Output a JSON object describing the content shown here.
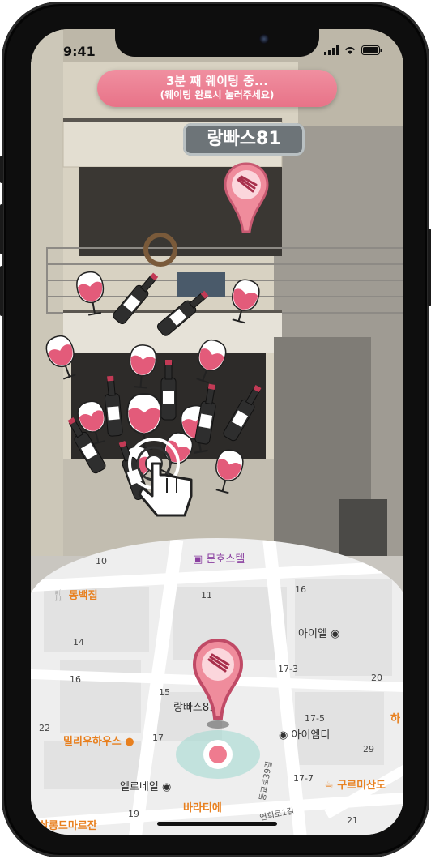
{
  "status_bar": {
    "time": "9:41"
  },
  "banner": {
    "line1": "3분 째 웨이팅 중...",
    "line2": "(웨이팅 완료시 눌러주세요)"
  },
  "place_name": "랑빠스81",
  "colors": {
    "accent": "#e87388",
    "banner_text": "#ffffff",
    "map_orange": "#e8801f"
  },
  "map": {
    "labels": {
      "munhostel": "문호스텔",
      "dongbaek": "동백집",
      "aiel": "아이엘",
      "langpas": "랑빠스81",
      "aiemdi": "아이엠디",
      "milliu": "밀리우하우스",
      "elnail": "엘르네일",
      "barati": "바라티에",
      "gurumi": "구르미산도",
      "salong": "살롱드마르잔",
      "ha": "하",
      "road1": "동교로39길",
      "road2": "연희로1길"
    },
    "numbers": [
      "10",
      "11",
      "16",
      "14",
      "16",
      "17-3",
      "20",
      "15",
      "17-5",
      "22",
      "17",
      "29",
      "17-7",
      "19",
      "21"
    ]
  }
}
